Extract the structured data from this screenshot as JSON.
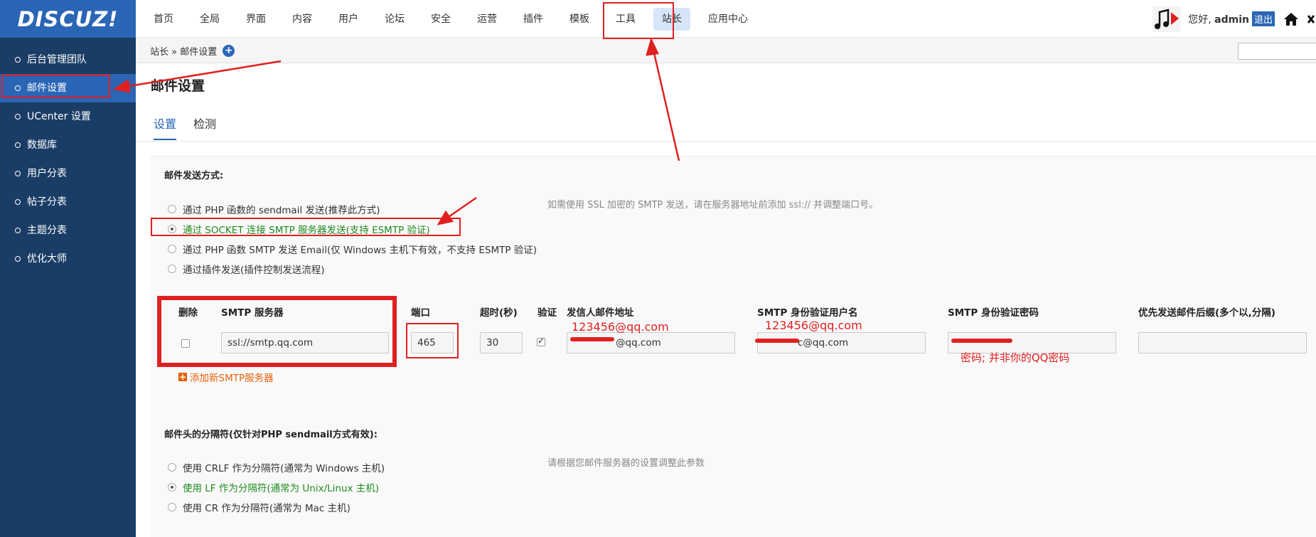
{
  "logo": "DISCUZ!",
  "nav": [
    "首页",
    "全局",
    "界面",
    "内容",
    "用户",
    "论坛",
    "安全",
    "运营",
    "插件",
    "模板",
    "工具",
    "站长",
    "应用中心"
  ],
  "user": {
    "greeting": "您好,",
    "name": "admin",
    "logout": "退出"
  },
  "sidebar": [
    {
      "label": "后台管理团队"
    },
    {
      "label": "邮件设置"
    },
    {
      "label": "UCenter 设置"
    },
    {
      "label": "数据库"
    },
    {
      "label": "用户分表"
    },
    {
      "label": "帖子分表"
    },
    {
      "label": "主题分表"
    },
    {
      "label": "优化大师"
    }
  ],
  "breadcrumb": "站长 » 邮件设置",
  "page_title": "邮件设置",
  "tabs": [
    "设置",
    "检测"
  ],
  "send_method": {
    "label": "邮件发送方式:",
    "hint": "如需使用 SSL 加密的 SMTP 发送，请在服务器地址前添加 ssl:// 并调整端口号。",
    "options": [
      "通过 PHP 函数的 sendmail 发送(推荐此方式)",
      "通过 SOCKET 连接 SMTP 服务器发送(支持 ESMTP 验证)",
      "通过 PHP 函数 SMTP 发送 Email(仅 Windows 主机下有效，不支持 ESMTP 验证)",
      "通过插件发送(插件控制发送流程)"
    ],
    "selected_index": 1
  },
  "smtp": {
    "headers": {
      "delete": "删除",
      "server": "SMTP 服务器",
      "port": "端口",
      "timeout": "超时(秒)",
      "auth": "验证",
      "from": "发信人邮件地址",
      "user": "SMTP 身份验证用户名",
      "password": "SMTP 身份验证密码",
      "suffix": "优先发送邮件后缀(多个以,分隔)"
    },
    "row": {
      "server": "ssl://smtp.qq.com",
      "port": "465",
      "timeout": "30",
      "from": "@qq.com",
      "user": "c@qq.com",
      "password": "",
      "suffix": ""
    },
    "add_label": "添加新SMTP服务器"
  },
  "separator": {
    "label": "邮件头的分隔符(仅针对PHP sendmail方式有效):",
    "hint": "请根据您邮件服务器的设置调整此参数",
    "options": [
      "使用 CRLF 作为分隔符(通常为 Windows 主机)",
      "使用 LF 作为分隔符(通常为 Unix/Linux 主机)",
      "使用 CR 作为分隔符(通常为 Mac 主机)"
    ],
    "selected_index": 1
  },
  "annotations": {
    "from_example": "123456@qq.com",
    "user_example": "123456@qq.com",
    "password_note": "密码;  并非你的QQ密码"
  },
  "colors": {
    "brand": "#2a66b5",
    "sidebar": "#1a3d66",
    "annotation": "#e02020",
    "selected_option": "#1e8a1e",
    "add_link": "#e6620b"
  }
}
